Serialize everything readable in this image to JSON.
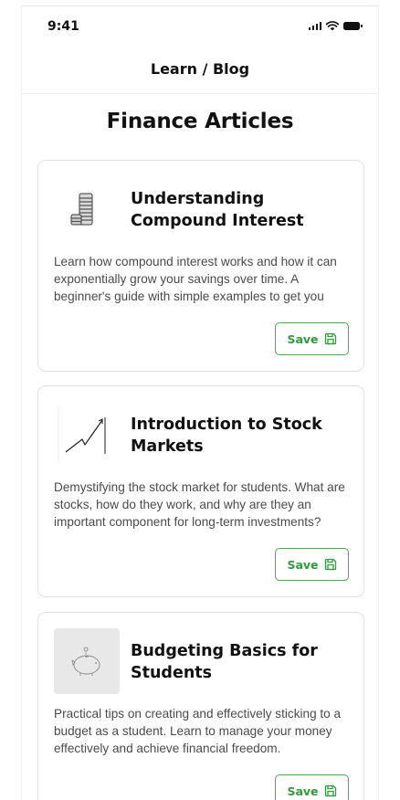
{
  "status_bar": {
    "time": "9:41"
  },
  "header": {
    "title": "Learn / Blog"
  },
  "page": {
    "title": "Finance Articles"
  },
  "articles": [
    {
      "title": "Understanding Compound Interest",
      "description": "Learn how compound interest works and how it can exponentially grow your savings over time. A beginner's guide with simple examples to get you",
      "save_label": "Save",
      "thumbnail_icon": "coin-stack-icon"
    },
    {
      "title": "Introduction to Stock Markets",
      "description": "Demystifying the stock market for students. What are stocks, how do they work, and why are they an important component for long-term investments?",
      "save_label": "Save",
      "thumbnail_icon": "stock-chart-icon"
    },
    {
      "title": "Budgeting Basics for Students",
      "description": "Practical tips on creating and effectively sticking to a budget as a student. Learn to manage your money effectively and achieve financial freedom.",
      "save_label": "Save",
      "thumbnail_icon": "piggy-bank-icon"
    }
  ],
  "colors": {
    "accent": "#2f9b3d",
    "accent_border": "#3fae4c",
    "card_border": "#e2e2e2"
  }
}
